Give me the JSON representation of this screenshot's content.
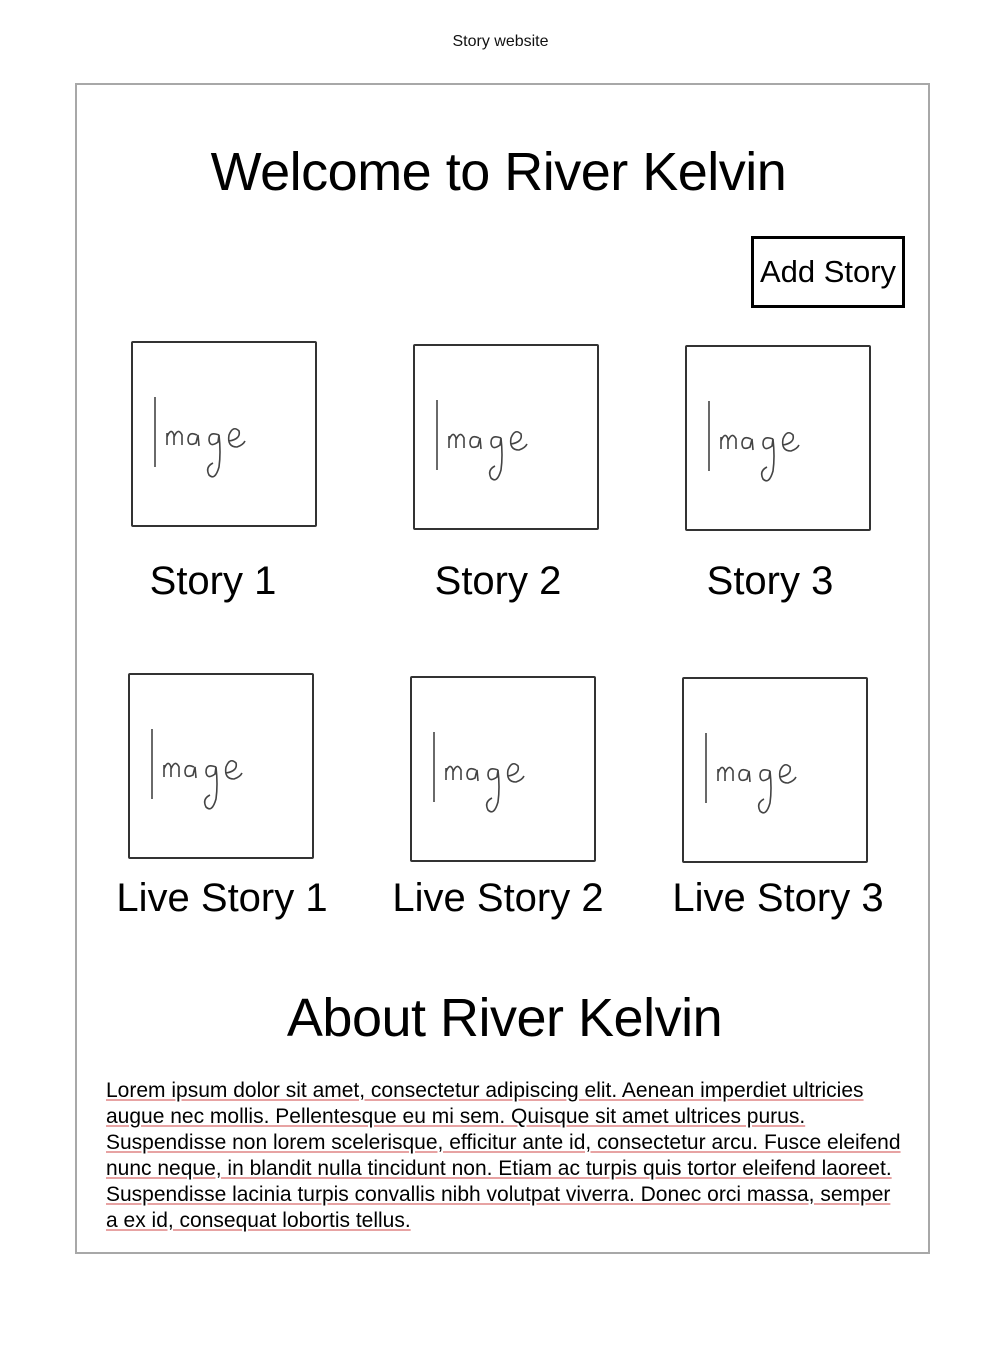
{
  "page": {
    "caption": "Story website"
  },
  "header": {
    "title": "Welcome to River Kelvin",
    "add_story_label": "Add Story"
  },
  "stories": [
    {
      "label": "Story 1",
      "image_text": "Image"
    },
    {
      "label": "Story 2",
      "image_text": "Image"
    },
    {
      "label": "Story 3",
      "image_text": "Image"
    }
  ],
  "live_stories": [
    {
      "label": "Live Story 1",
      "image_text": "Image"
    },
    {
      "label": "Live Story 2",
      "image_text": "Image"
    },
    {
      "label": "Live Story 3",
      "image_text": "Image"
    }
  ],
  "about": {
    "title": "About River Kelvin",
    "body": "Lorem ipsum dolor sit amet, consectetur adipiscing elit. Aenean imperdiet ultricies augue nec mollis. Pellentesque eu mi sem. Quisque sit amet ultrices purus. Suspendisse non lorem scelerisque, efficitur ante id, consectetur arcu. Fusce eleifend nunc neque, in blandit nulla tincidunt non. Etiam ac turpis quis tortor eleifend laoreet. Suspendisse lacinia turpis convallis nibh volutpat viverra. Donec orci massa, semper a ex id, consequat lobortis tellus."
  },
  "icons": {
    "image_placeholder": "image-placeholder-icon"
  }
}
